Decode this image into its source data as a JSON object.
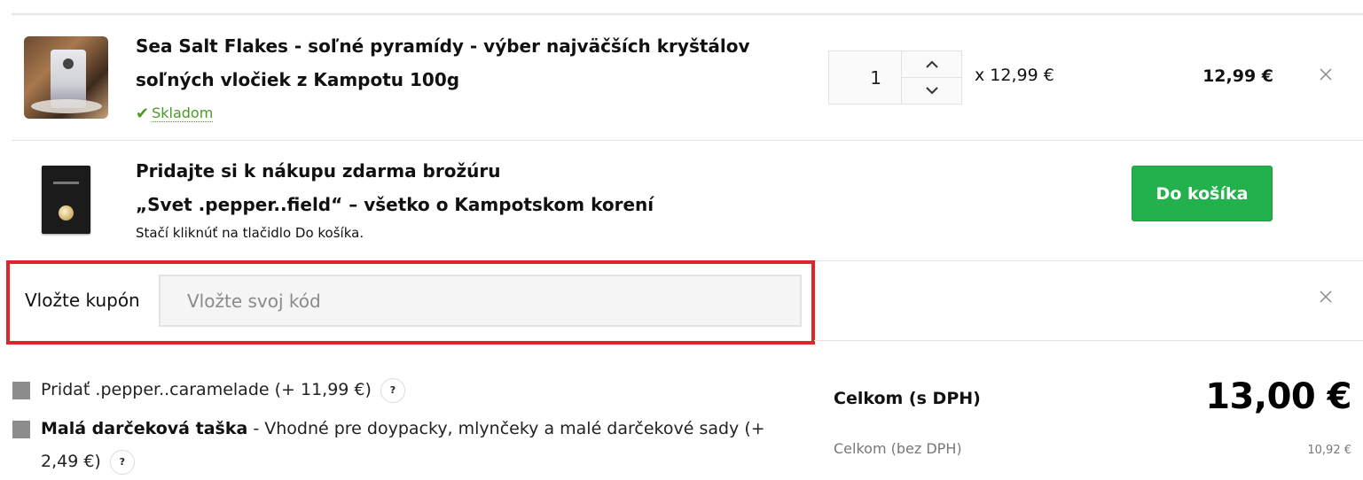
{
  "cart_item": {
    "title": "Sea Salt Flakes - soľné pyramídy - výber najväčších kryštálov soľných vločiek z Kampotu 100g",
    "stock_status": "Skladom",
    "quantity": "1",
    "unit_price": "x 12,99 €",
    "line_total": "12,99 €"
  },
  "free_brochure": {
    "title_line1": "Pridajte si k nákupu zdarma brožúru",
    "title_line2": "„Svet .pepper..field“ – všetko o Kampotskom korení",
    "note": "Stačí kliknúť na tlačidlo Do košíka.",
    "button_label": "Do košíka"
  },
  "coupon": {
    "label": "Vložte kupón",
    "placeholder": "Vložte svoj kód",
    "value": ""
  },
  "addons": [
    {
      "text": "Pridať .pepper..caramelade (+ 11,99 €)",
      "help": "?"
    },
    {
      "name": "Malá darčeková taška",
      "text": " - Vhodné pre doypacky, mlynčeky a malé darčekové sady (+ 2,49 €)",
      "help": "?"
    }
  ],
  "totals": {
    "total_label": "Celkom (s DPH)",
    "total_value": "13,00 €",
    "net_label": "Celkom (bez DPH)",
    "net_value": "10,92 €"
  },
  "colors": {
    "accent_green": "#22b14c",
    "stock_green": "#4a9a23",
    "highlight_red": "#e0242a"
  },
  "icons": {
    "stock": "check-icon",
    "qty_up": "chevron-up-icon",
    "qty_down": "chevron-down-icon",
    "remove": "close-icon"
  }
}
